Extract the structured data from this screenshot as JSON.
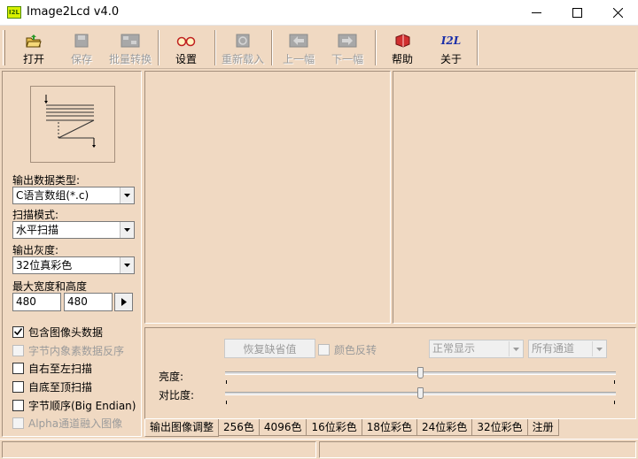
{
  "window": {
    "title": "Image2Lcd v4.0",
    "icon_text": "I2L",
    "icon_color": "#d8f000",
    "background": "#f0d9c2"
  },
  "toolbar": {
    "open_label": "打开",
    "save_label": "保存",
    "batch_label": "批量转换",
    "settings_label": "设置",
    "reload_label": "重新载入",
    "prev_label": "上一幅",
    "next_label": "下一幅",
    "help_label": "帮助",
    "about_label": "关于",
    "about_icon_text": "I2L"
  },
  "left_panel": {
    "output_type_label": "输出数据类型:",
    "output_type_value": "C语言数组(*.c)",
    "scan_mode_label": "扫描模式:",
    "scan_mode_value": "水平扫描",
    "gray_label": "输出灰度:",
    "gray_value": "32位真彩色",
    "size_label": "最大宽度和高度",
    "max_width": "480",
    "max_height": "480",
    "checkboxes": [
      {
        "label": "包含图像头数据",
        "checked": true,
        "enabled": true
      },
      {
        "label": "字节内象素数据反序",
        "checked": false,
        "enabled": false
      },
      {
        "label": "自右至左扫描",
        "checked": false,
        "enabled": true
      },
      {
        "label": "自底至顶扫描",
        "checked": false,
        "enabled": true
      },
      {
        "label": "字节顺序(Big Endian)",
        "checked": false,
        "enabled": true
      },
      {
        "label": "Alpha通道融入图像",
        "checked": false,
        "enabled": false
      }
    ]
  },
  "adjust": {
    "restore_label": "恢复缺省值",
    "invert_label": "颜色反转",
    "display_mode": "正常显示",
    "channel": "所有通道",
    "brightness_label": "亮度:",
    "contrast_label": "对比度:",
    "brightness_level": 0.5,
    "contrast_level": 0.5
  },
  "tabs": [
    "输出图像调整",
    "256色",
    "4096色",
    "16位彩色",
    "18位彩色",
    "24位彩色",
    "32位彩色",
    "注册"
  ],
  "active_tab": 0
}
